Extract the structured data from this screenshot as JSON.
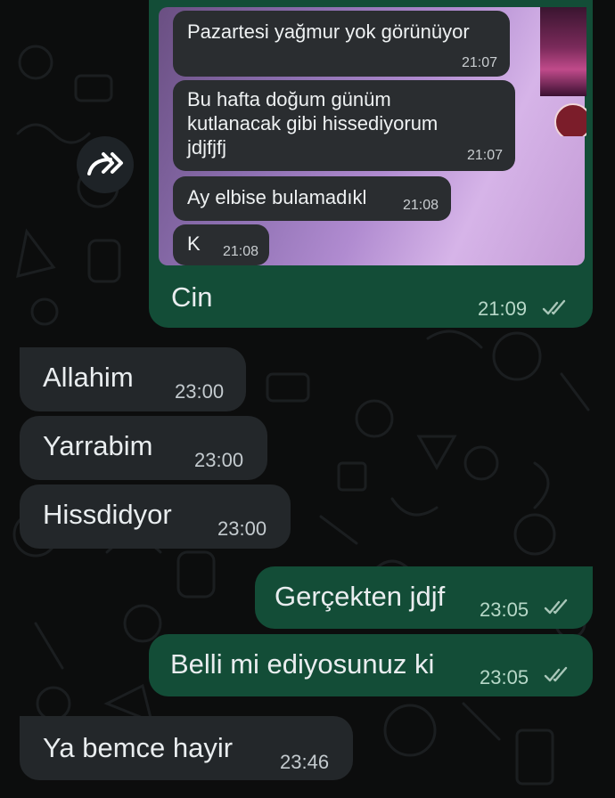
{
  "quoted": {
    "messages": [
      {
        "text": "Pazartesi yağmur yok görünüyor",
        "time": "21:07"
      },
      {
        "text": "Bu hafta doğum günüm kutlanacak gibi hissediyorum jdjfjfj",
        "time": "21:07"
      },
      {
        "text": "Ay elbise bulamadıkl",
        "time": "21:08"
      },
      {
        "text": "K",
        "time": "21:08"
      }
    ]
  },
  "reply": {
    "text": "Cin",
    "time": "21:09",
    "status": "read"
  },
  "messages": [
    {
      "text": "Allahim",
      "time": "23:00",
      "direction": "in"
    },
    {
      "text": "Yarrabim",
      "time": "23:00",
      "direction": "in"
    },
    {
      "text": "Hissdidyor",
      "time": "23:00",
      "direction": "in"
    },
    {
      "text": "Gerçekten jdjf",
      "time": "23:05",
      "direction": "out",
      "status": "read"
    },
    {
      "text": "Belli mi ediyosunuz ki",
      "time": "23:05",
      "direction": "out",
      "status": "read"
    },
    {
      "text": "Ya bemce hayir",
      "time": "23:46",
      "direction": "in"
    }
  ],
  "colors": {
    "background": "#0c0d0d",
    "incoming_bubble": "#23272a",
    "outgoing_bubble": "#134d37"
  },
  "icons": {
    "forward": "forward-arrow-icon",
    "read_receipt": "double-check-icon"
  }
}
